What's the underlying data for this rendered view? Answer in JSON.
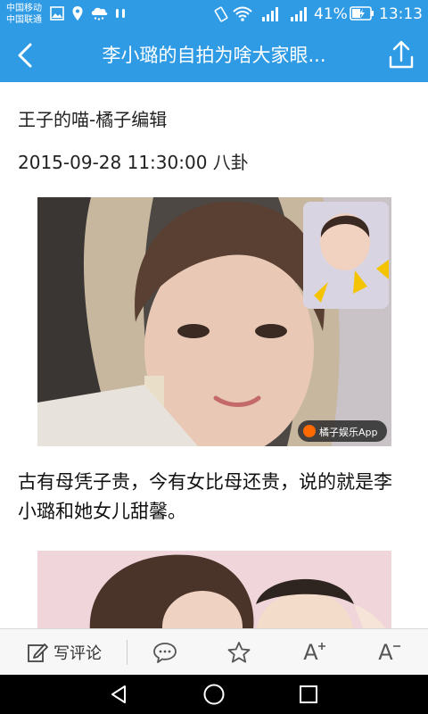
{
  "status_bar": {
    "carrier_1": "中国移动",
    "carrier_2": "中国联通",
    "battery_percent": "41%",
    "time": "13:13",
    "icons": [
      "image-icon",
      "location-icon",
      "weather-icon",
      "voicemail-icon",
      "vibrate-icon",
      "wifi-icon",
      "signal-icon",
      "signal-icon",
      "battery-charging-icon"
    ]
  },
  "header": {
    "title": "李小璐的自拍为啥大家眼...",
    "back_icon": "chevron-left-icon",
    "share_icon": "share-icon",
    "background_color": "#2f9be4"
  },
  "article": {
    "author": "王子的喵-橘子编辑",
    "meta": "2015-09-28 11:30:00 八卦",
    "watermark_text": "橘子娱乐App",
    "paragraph": "古有母凭子贵，今有女比母还贵，说的就是李小璐和她女儿甜馨。"
  },
  "toolbar": {
    "comment_label": "写评论",
    "comment_icon": "edit-icon",
    "chat_icon": "comment-bubble-icon",
    "favorite_icon": "star-icon",
    "font_increase_label": "A",
    "font_decrease_label": "A"
  },
  "nav_bar": {
    "back_icon": "triangle-back-icon",
    "home_icon": "circle-home-icon",
    "recents_icon": "square-recents-icon"
  }
}
